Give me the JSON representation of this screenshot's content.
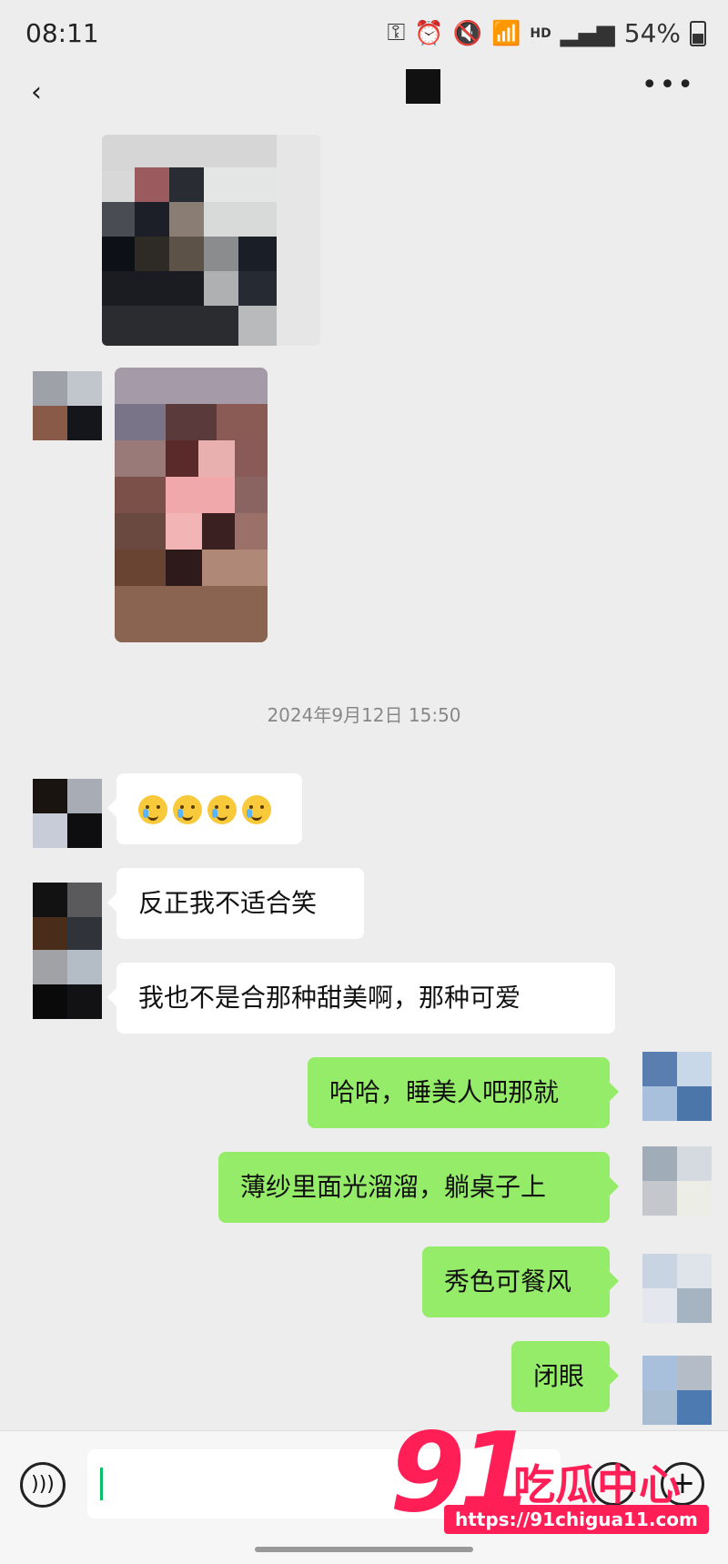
{
  "status": {
    "time": "08:11",
    "hd": "HD",
    "battery": "54%"
  },
  "titlebar": {
    "back_icon": "chevron-left-icon",
    "more_icon": "more-icon"
  },
  "chat": {
    "timestamp": "2024年9月12日 15:50",
    "messages": [
      {
        "side": "left",
        "text": ""
      },
      {
        "side": "left",
        "text": "反正我不适合笑"
      },
      {
        "side": "left",
        "text": "我也不是合那种甜美啊，那种可爱"
      },
      {
        "side": "right",
        "text": "哈哈，睡美人吧那就"
      },
      {
        "side": "right",
        "text": "薄纱里面光溜溜，躺桌子上"
      },
      {
        "side": "right",
        "text": "秀色可餐风"
      },
      {
        "side": "right",
        "text": "闭眼"
      }
    ]
  },
  "input": {
    "voice_icon": "voice-icon",
    "emoji_icon": "emoji-icon",
    "plus_icon": "plus-icon"
  },
  "watermark": {
    "number": "91",
    "name": "吃瓜中心",
    "url": "https://91chigua11.com"
  }
}
